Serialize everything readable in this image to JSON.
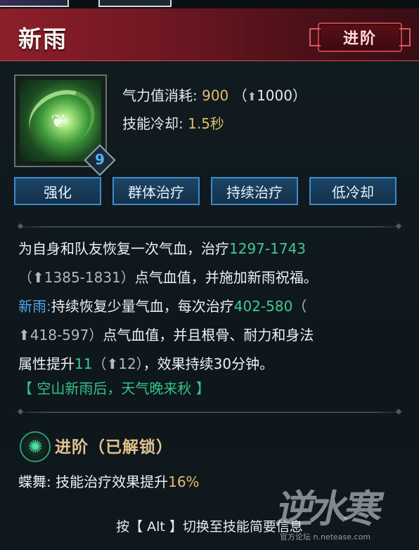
{
  "skill": {
    "name": "新雨",
    "level": "9",
    "advance_button": "进阶"
  },
  "stats": {
    "cost_label": "气力值消耗:",
    "cost_value": "900",
    "cost_upgraded": "1000",
    "cooldown_label": "技能冷却:",
    "cooldown_value": "1.5秒"
  },
  "tags": [
    "强化",
    "群体治疗",
    "持续治疗",
    "低冷却"
  ],
  "description": {
    "line1_text": "为自身和队友恢复一次气血，治疗",
    "line1_heal": "1297-1743",
    "line2_upgraded": "1385-1831",
    "line2_text": "点气血值，并施加新雨祝福。",
    "line3_name": "新雨:",
    "line3_text": "持续恢复少量气血，每次治疗",
    "line3_heal": "402-580",
    "line4_upgraded": "418-597",
    "line4_text": "点气血值，并且根骨、耐力和身法",
    "line5_text": "属性提升",
    "line5_value": "11",
    "line5_upgraded": "12",
    "line5_tail": "，效果持续30分钟。",
    "quote": "【 空山新雨后，天气晚来秋 】"
  },
  "advance": {
    "title": "进阶（已解锁）",
    "effect_name": "蝶舞:",
    "effect_text": "技能治疗效果提升",
    "effect_value": "16%"
  },
  "hint": "按【 Alt 】切换至技能简要信息",
  "watermark": {
    "logo": "逆水寒",
    "site": "官方论坛 n.netease.com"
  },
  "icons": {
    "upgrade_arrow": "up-arrow-icon",
    "advance": "swirl-icon"
  },
  "colors": {
    "header": "#8d1f2a",
    "gold": "#e1be6a",
    "heal_green": "#3fc993",
    "name_blue": "#57a6ee",
    "tag_border": "#3d8ccc"
  }
}
